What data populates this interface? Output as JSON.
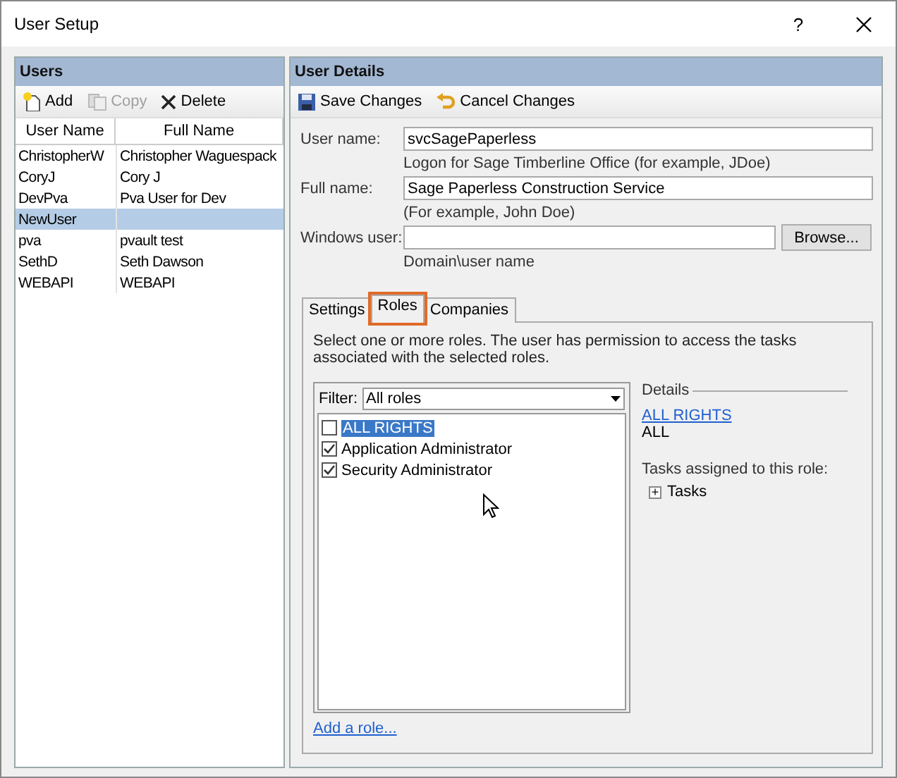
{
  "window": {
    "title": "User Setup",
    "help_button": "?"
  },
  "users_panel": {
    "title": "Users",
    "toolbar": [
      {
        "label": "Add",
        "kind": "add",
        "disabled": false
      },
      {
        "label": "Copy",
        "kind": "copy",
        "disabled": true
      },
      {
        "label": "Delete",
        "kind": "delete",
        "disabled": false
      }
    ],
    "columns": [
      "User Name",
      "Full Name"
    ],
    "rows": [
      {
        "cells": [
          "ChristopherW",
          "Christopher Waguespack"
        ],
        "selected": false
      },
      {
        "cells": [
          "CoryJ",
          "Cory J"
        ],
        "selected": false
      },
      {
        "cells": [
          "DevPva",
          "Pva User for Dev"
        ],
        "selected": false
      },
      {
        "cells": [
          "NewUser"
        ],
        "selected": true
      },
      {
        "cells": [
          "pva",
          "pvault test"
        ],
        "selected": false
      },
      {
        "cells": [
          "SethD",
          "Seth Dawson"
        ],
        "selected": false
      },
      {
        "cells": [
          "WEBAPI",
          "WEBAPI"
        ],
        "selected": false
      }
    ]
  },
  "details_panel": {
    "title": "User Details",
    "toolbar": [
      {
        "label": "Save Changes",
        "kind": "save"
      },
      {
        "label": "Cancel Changes",
        "kind": "undo"
      }
    ],
    "fields": [
      {
        "label": "User name:",
        "value": "svcSagePaperless",
        "hint": "Logon for Sage Timberline Office (for example, JDoe)"
      },
      {
        "label": "Full name:",
        "value": "Sage Paperless Construction Service",
        "hint": "(For example, John Doe)"
      },
      {
        "label": "Windows user:",
        "button": "Browse...",
        "hint": "Domain\\user name"
      }
    ],
    "tabs": [
      {
        "label": "Settings",
        "selected": false,
        "highlighted": false
      },
      {
        "label": "Roles",
        "selected": true,
        "highlighted": true
      },
      {
        "label": "Companies",
        "selected": false,
        "highlighted": false
      }
    ],
    "roles": {
      "description": "Select one or more roles. The user has permission to access the tasks associated with the selected roles.",
      "filter_label": "Filter:",
      "filter_value": "All roles",
      "items": [
        {
          "label": "ALL RIGHTS",
          "checked": false,
          "selected": true
        },
        {
          "label": "Application Administrator",
          "checked": true,
          "selected": false
        },
        {
          "label": "Security Administrator",
          "checked": true,
          "selected": false
        }
      ],
      "details_title": "Details",
      "details_link": "ALL RIGHTS",
      "details_value": "ALL",
      "tasks_label": "Tasks assigned to this role:",
      "tasks_node": "Tasks",
      "tasks_expander": "+",
      "add_link": "Add a role..."
    }
  }
}
